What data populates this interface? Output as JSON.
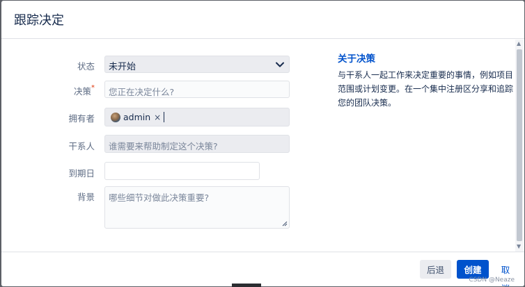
{
  "dialog": {
    "title": "跟踪决定"
  },
  "form": {
    "status": {
      "label": "状态",
      "value": "未开始"
    },
    "decision": {
      "label": "决策",
      "required_mark": "*",
      "placeholder": "您正在决定什么?"
    },
    "owner": {
      "label": "拥有者",
      "chip_label": "admin",
      "chip_remove": "×"
    },
    "stakeholders": {
      "label": "干系人",
      "placeholder": "谁需要来帮助制定这个决策?"
    },
    "due_date": {
      "label": "到期日",
      "value": ""
    },
    "background": {
      "label": "背景",
      "placeholder": "哪些细节对做此决策重要?"
    }
  },
  "sidebar": {
    "title": "关于决策",
    "text": "与干系人一起工作来决定重要的事情，例如项目范围或计划变更。在一个集中注册区分享和追踪您的团队决策。"
  },
  "footer": {
    "back_label": "后退",
    "create_label": "创建",
    "cancel_label": "取消",
    "watermark": "CSDN @Neaze"
  },
  "colors": {
    "primary": "#0052cc",
    "required": "#de350b",
    "field_border": "#dfe1e6",
    "label": "#5e6c84"
  },
  "icons": [
    "chevron-down-icon",
    "avatar",
    "close-icon",
    "resize-handle-icon"
  ]
}
